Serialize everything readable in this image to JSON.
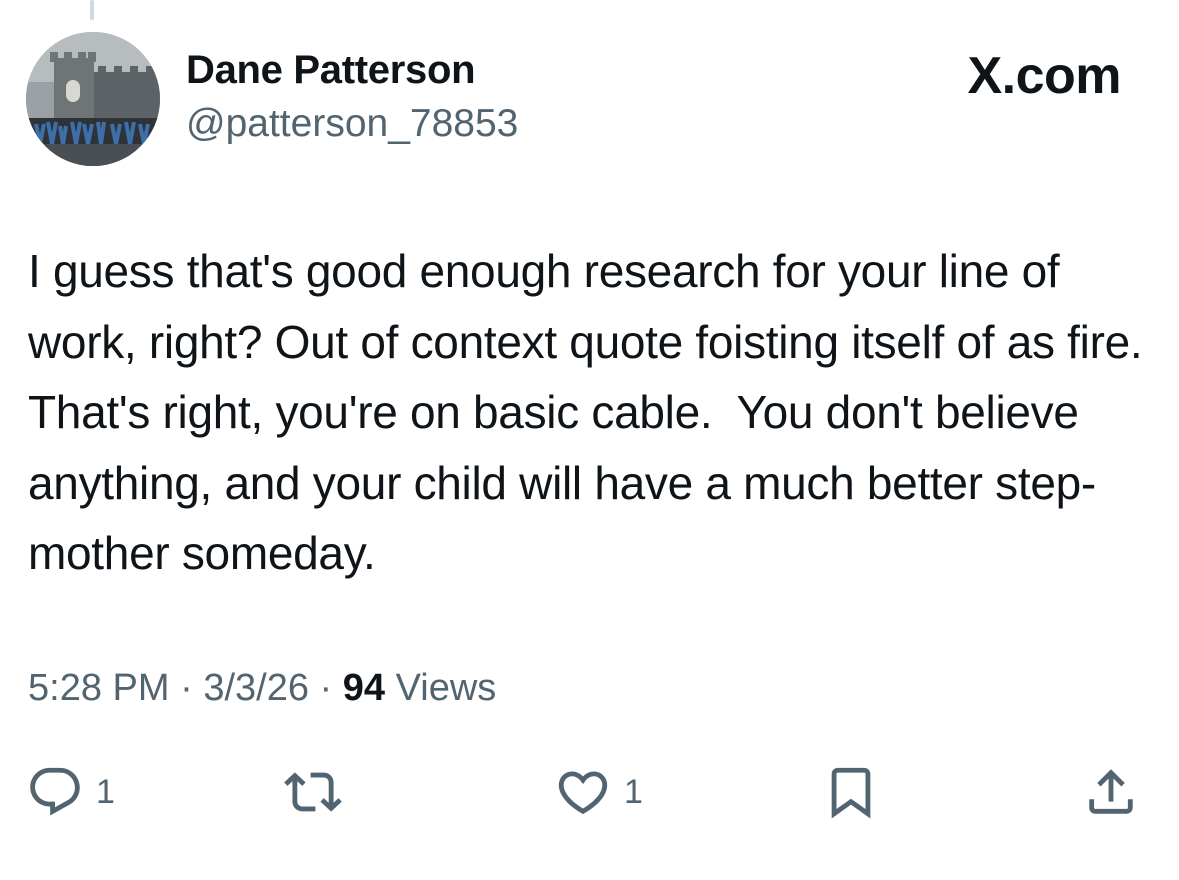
{
  "author": {
    "display_name": "Dane Patterson",
    "handle": "@patterson_78853"
  },
  "brand": {
    "label": "X.com"
  },
  "tweet": {
    "text": "I guess that's good enough research for your line of work, right? Out of context quote foisting itself of as fire. That's right, you're on basic cable.  You don't believe anything, and your child will have a much better step-mother someday."
  },
  "meta": {
    "time": "5:28 PM",
    "sep1": " · ",
    "date": "3/3/26",
    "sep2": " · ",
    "views_count": "94",
    "views_label": " Views"
  },
  "actions": {
    "reply": {
      "icon": "reply-icon",
      "count": "1"
    },
    "repost": {
      "icon": "repost-icon",
      "count": ""
    },
    "like": {
      "icon": "heart-icon",
      "count": "1"
    },
    "bookmark": {
      "icon": "bookmark-icon",
      "count": ""
    },
    "share": {
      "icon": "share-icon",
      "count": ""
    }
  },
  "colors": {
    "text_primary": "#0f1419",
    "text_secondary": "#536471",
    "background": "#ffffff"
  }
}
